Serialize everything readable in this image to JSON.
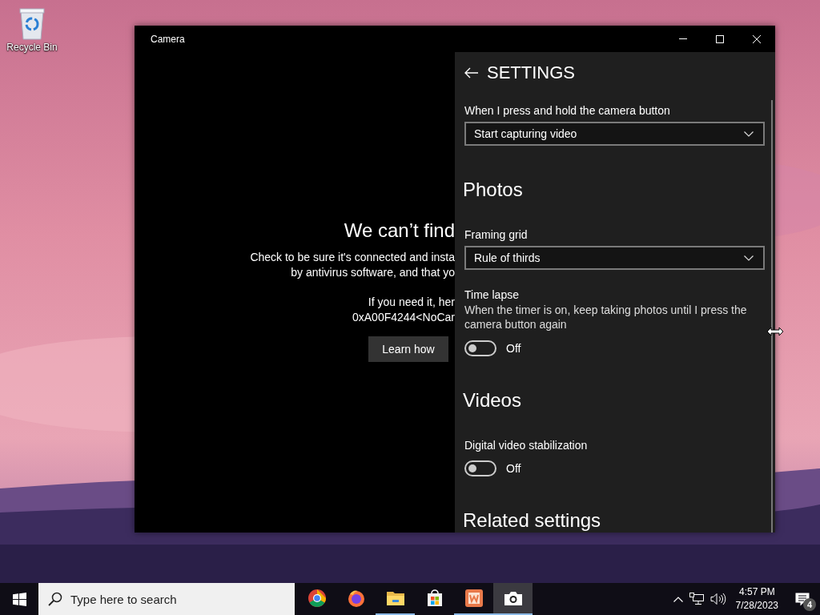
{
  "desktop": {
    "icons": [
      {
        "label": "Recycle Bin"
      }
    ]
  },
  "window": {
    "title": "Camera",
    "error": {
      "heading": "We can’t find",
      "lines": [
        "Check to be sure it's connected and insta",
        "by antivirus software, and that yo"
      ],
      "code_lines": [
        "If you need it, her",
        "0xA00F4244<NoCar"
      ],
      "button": "Learn how"
    },
    "settings": {
      "title": "SETTINGS",
      "items": [
        {
          "kind": "dropdown",
          "label": "When I press and hold the camera button",
          "value": "Start capturing video"
        },
        {
          "kind": "heading",
          "label": "Photos"
        },
        {
          "kind": "dropdown",
          "label": "Framing grid",
          "value": "Rule of thirds"
        },
        {
          "kind": "toggle",
          "label": "Time lapse",
          "description": "When the timer is on, keep taking photos until I press the camera button again",
          "on": false,
          "state_label": "Off"
        },
        {
          "kind": "heading",
          "label": "Videos"
        },
        {
          "kind": "toggle",
          "label": "Digital video stabilization",
          "on": false,
          "state_label": "Off"
        },
        {
          "kind": "heading",
          "label": "Related settings"
        }
      ]
    }
  },
  "taskbar": {
    "search": {
      "placeholder": "Type here to search"
    },
    "apps": [
      {
        "kind": "chrome",
        "running": false,
        "selected": false
      },
      {
        "kind": "firefox",
        "running": false,
        "selected": false
      },
      {
        "kind": "folder",
        "running": true,
        "selected": false
      },
      {
        "kind": "store",
        "running": false,
        "selected": false
      },
      {
        "kind": "orange",
        "running": true,
        "selected": false
      },
      {
        "kind": "camera",
        "running": true,
        "selected": true
      }
    ],
    "clock": {
      "time": "4:57 PM",
      "date": "7/28/2023"
    },
    "notifications": {
      "count": "4"
    }
  }
}
